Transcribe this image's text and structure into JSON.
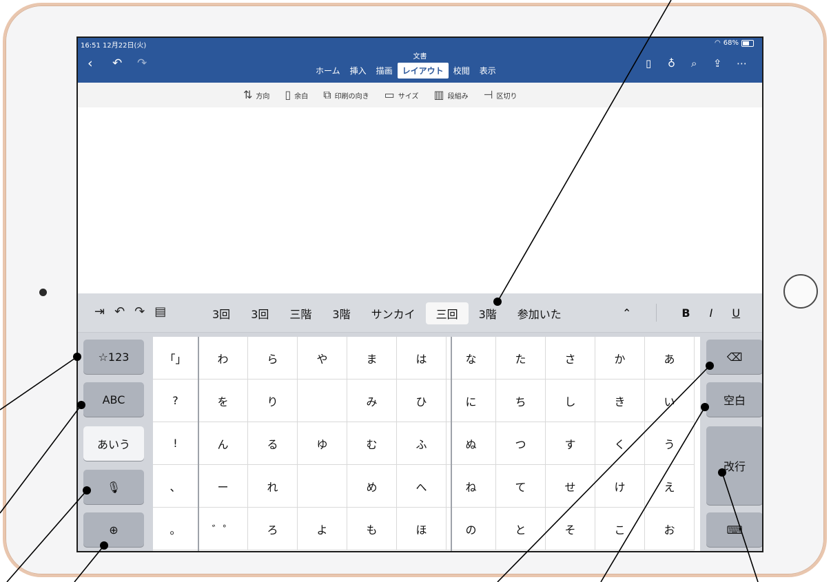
{
  "status": {
    "time": "16:51  12月22日(火)",
    "battery": "68%"
  },
  "header": {
    "doc_title": "文書",
    "tabs": [
      {
        "label": "ホーム",
        "active": false
      },
      {
        "label": "挿入",
        "active": false
      },
      {
        "label": "描画",
        "active": false
      },
      {
        "label": "レイアウト",
        "active": true
      },
      {
        "label": "校閲",
        "active": false
      },
      {
        "label": "表示",
        "active": false
      }
    ],
    "icons_left": [
      "back-icon",
      "undo-icon",
      "redo-icon"
    ],
    "icons_right": [
      "phone-view-icon",
      "lightbulb-icon",
      "search-icon",
      "share-icon",
      "more-icon"
    ]
  },
  "ribbon": {
    "items": [
      {
        "label": "方向",
        "icon": "text-direction-icon"
      },
      {
        "label": "余白",
        "icon": "margins-icon"
      },
      {
        "label": "印刷の向き",
        "icon": "orientation-icon"
      },
      {
        "label": "サイズ",
        "icon": "page-size-icon"
      },
      {
        "label": "段組み",
        "icon": "columns-icon"
      },
      {
        "label": "区切り",
        "icon": "breaks-icon"
      }
    ]
  },
  "keyboard": {
    "candidates": [
      "3回",
      "3回",
      "三階",
      "3階",
      "サンカイ",
      "三回",
      "3階",
      "参加いた"
    ],
    "selected_index": 5,
    "format": {
      "bold": "B",
      "italic": "I",
      "underline": "U"
    },
    "left_keys": [
      "☆123",
      "ABC",
      "あいう"
    ],
    "right_keys": {
      "space": "空白",
      "enter": "改行"
    },
    "grid": [
      [
        "「」",
        "わ",
        "ら",
        "や",
        "ま",
        "は",
        "な",
        "た",
        "さ",
        "か",
        "あ"
      ],
      [
        "?",
        "を",
        "り",
        "",
        "み",
        "ひ",
        "に",
        "ち",
        "し",
        "き",
        "い"
      ],
      [
        "!",
        "ん",
        "る",
        "ゆ",
        "む",
        "ふ",
        "ぬ",
        "つ",
        "す",
        "く",
        "う"
      ],
      [
        "、",
        "ー",
        "れ",
        "",
        "め",
        "へ",
        "ね",
        "て",
        "せ",
        "け",
        "え"
      ],
      [
        "。",
        "゛゜",
        "ろ",
        "よ",
        "も",
        "ほ",
        "の",
        "と",
        "そ",
        "こ",
        "お"
      ]
    ]
  },
  "colors": {
    "header": "#2b579a",
    "keyboard": "#d2d5db",
    "frame": "#e9c6ae"
  }
}
